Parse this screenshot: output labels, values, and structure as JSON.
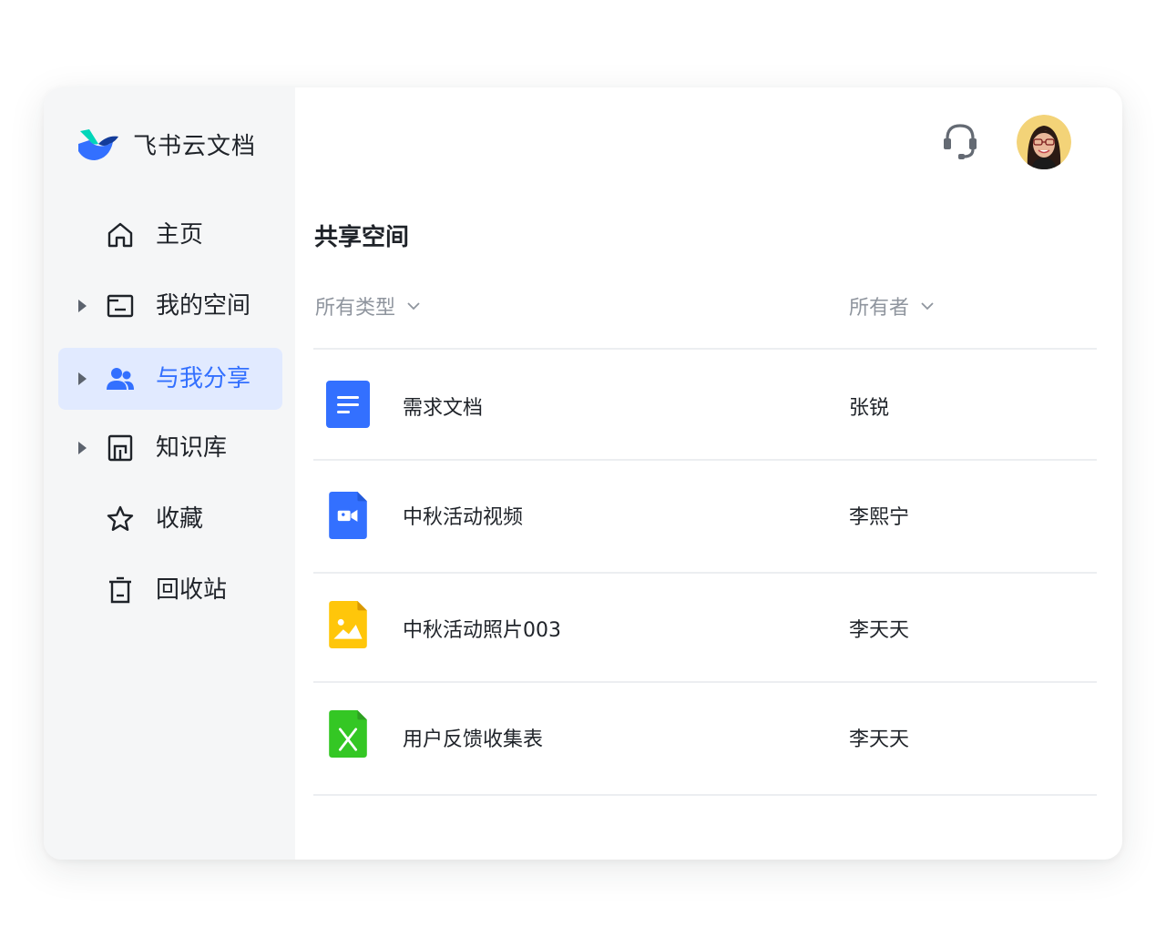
{
  "app": {
    "name": "飞书云文档"
  },
  "sidebar": {
    "items": [
      {
        "label": "主页",
        "icon": "home-icon",
        "expandable": false,
        "active": false
      },
      {
        "label": "我的空间",
        "icon": "folder-icon",
        "expandable": true,
        "active": false
      },
      {
        "label": "与我分享",
        "icon": "users-icon",
        "expandable": true,
        "active": true
      },
      {
        "label": "知识库",
        "icon": "wiki-icon",
        "expandable": true,
        "active": false
      },
      {
        "label": "收藏",
        "icon": "star-icon",
        "expandable": false,
        "active": false
      },
      {
        "label": "回收站",
        "icon": "trash-icon",
        "expandable": false,
        "active": false
      }
    ]
  },
  "header": {
    "support_icon": "headset-icon",
    "avatar": "user-avatar"
  },
  "main": {
    "title": "共享空间",
    "filters": {
      "type": "所有类型",
      "owner": "所有者"
    },
    "files": [
      {
        "name": "需求文档",
        "owner": "张锐",
        "type": "doc",
        "icon": "doc-file-icon"
      },
      {
        "name": "中秋活动视频",
        "owner": "李熙宁",
        "type": "video",
        "icon": "video-file-icon"
      },
      {
        "name": "中秋活动照片003",
        "owner": "李天天",
        "type": "image",
        "icon": "image-file-icon"
      },
      {
        "name": "用户反馈收集表",
        "owner": "李天天",
        "type": "sheet",
        "icon": "sheet-file-icon"
      }
    ]
  },
  "colors": {
    "accent": "#3370ff",
    "sidebar_bg": "#f5f6f7",
    "active_bg": "#e1eaff",
    "doc_blue": "#3370ff",
    "image_yellow": "#ffc60a",
    "sheet_green": "#34c724"
  }
}
